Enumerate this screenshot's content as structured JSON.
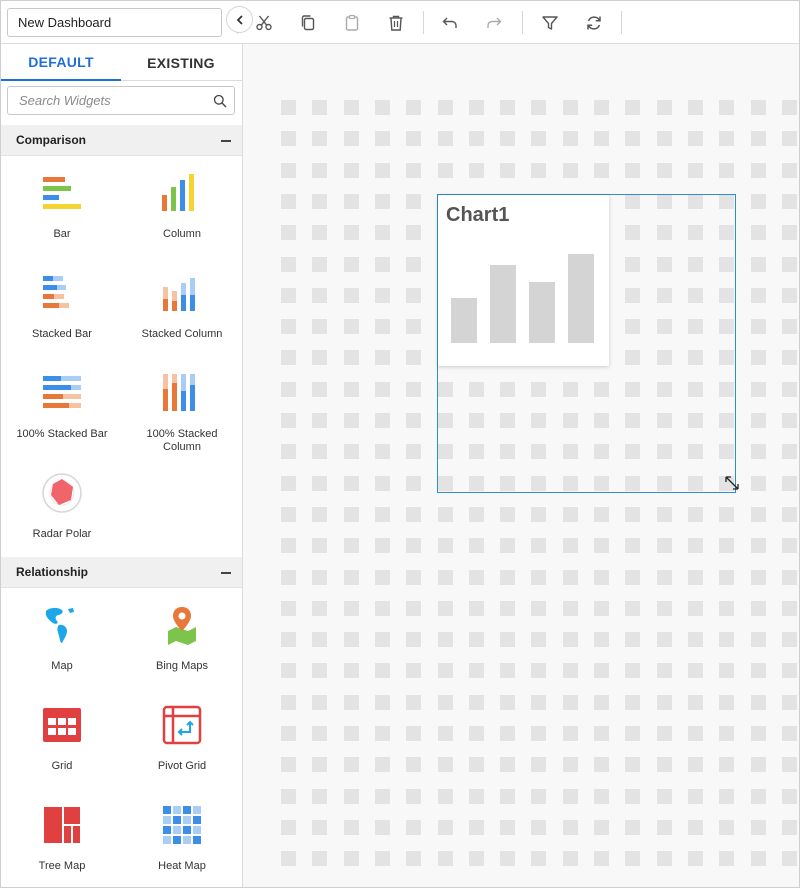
{
  "toolbar": {
    "dashboard_name": "New Dashboard",
    "buttons": [
      "cut-icon",
      "copy-icon",
      "paste-icon",
      "delete-icon",
      "undo-icon",
      "redo-icon",
      "filter-icon",
      "refresh-icon"
    ]
  },
  "sidebar": {
    "tabs": {
      "default": "DEFAULT",
      "existing": "EXISTING"
    },
    "search": {
      "placeholder": "Search Widgets"
    },
    "groups": {
      "comparison": {
        "title": "Comparison",
        "items": [
          "Bar",
          "Column",
          "Stacked Bar",
          "Stacked Column",
          "100% Stacked Bar",
          "100% Stacked Column",
          "Radar Polar"
        ]
      },
      "relationship": {
        "title": "Relationship",
        "items": [
          "Map",
          "Bing Maps",
          "Grid",
          "Pivot Grid",
          "Tree Map",
          "Heat Map"
        ]
      }
    }
  },
  "canvas": {
    "widget": {
      "title": "Chart1",
      "placeholder_bar_levels": [
        0.5,
        0.88,
        0.68,
        1.0
      ]
    }
  },
  "colors": {
    "accent": "#1f6fd9",
    "selection": "#2d8fc4",
    "placeholder_bar": "#d4d4d4",
    "orange": "#e8783a",
    "blue": "#3c8ee8",
    "green": "#7cc44a",
    "yellow": "#f6d42f",
    "red": "#e04040"
  }
}
